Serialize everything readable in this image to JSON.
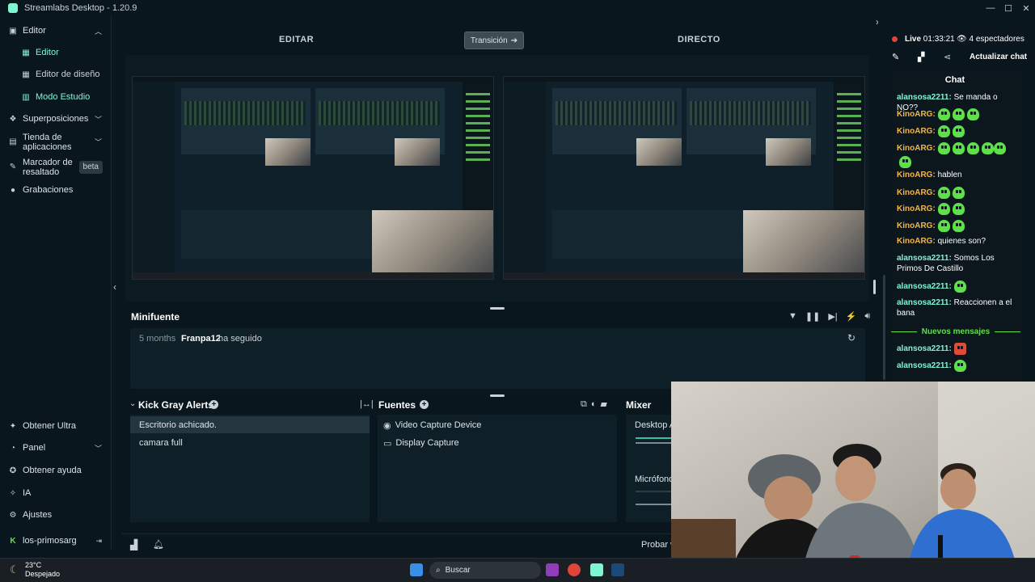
{
  "window": {
    "title": "Streamlabs Desktop - 1.20.9",
    "controls": [
      "—",
      "☐",
      "✕"
    ]
  },
  "sidebar": {
    "editor": "Editor",
    "editor_sub": [
      {
        "label": "Editor",
        "icon": "scene-icon",
        "active": true
      },
      {
        "label": "Editor de diseño",
        "icon": "layout-icon",
        "active": false
      },
      {
        "label": "Modo Estudio",
        "icon": "studio-icon",
        "active": true
      }
    ],
    "items": [
      {
        "label": "Superposiciones",
        "icon": "overlay-icon"
      },
      {
        "label": "Tienda de aplicaciones",
        "icon": "store-icon"
      },
      {
        "label": "Marcador de resaltado",
        "icon": "highlighter-icon",
        "badge": "beta"
      },
      {
        "label": "Grabaciones",
        "icon": "recordings-icon"
      }
    ],
    "bottom": [
      {
        "label": "Obtener Ultra",
        "icon": "ultra-icon"
      },
      {
        "label": "Panel",
        "icon": "dashboard-icon"
      },
      {
        "label": "Obtener ayuda",
        "icon": "help-icon"
      },
      {
        "label": "IA",
        "icon": "ai-icon"
      },
      {
        "label": "Ajustes",
        "icon": "settings-icon"
      },
      {
        "label": "los-primosarg",
        "icon": "kick-icon"
      }
    ]
  },
  "header": {
    "edit": "EDITAR",
    "transition": "Transición",
    "live": "DIRECTO"
  },
  "minifuente": {
    "title": "Minifuente",
    "event": {
      "time": "5 months",
      "user": "Franpa12",
      "action": "ha seguido"
    }
  },
  "scenes": {
    "title": "Kick Gray Alerts",
    "items": [
      "Escritorio achicado.",
      "camara full"
    ]
  },
  "sources": {
    "title": "Fuentes",
    "items": [
      "Video Capture Device",
      "Display Capture"
    ]
  },
  "mixer": {
    "title": "Mixer",
    "items": [
      "Desktop A",
      "Micrófono"
    ]
  },
  "bottombar": {
    "test": "Probar w"
  },
  "stream": {
    "live": "Live",
    "time": "01:33:21",
    "viewers": "4 espectadores",
    "refresh_chat": "Actualizar chat"
  },
  "chat": {
    "title": "Chat",
    "new_messages": "Nuevos mensajes",
    "lines": [
      {
        "user": "alansosa2211:",
        "text": "Se manda o NO??",
        "kind": "a"
      },
      {
        "user": "KinoARG:",
        "text": "",
        "kind": "k",
        "emotes": 3
      },
      {
        "user": "KinoARG:",
        "text": "",
        "kind": "k",
        "emotes": 2
      },
      {
        "user": "KinoARG:",
        "text": "",
        "kind": "k",
        "emotes": 6
      },
      {
        "user": "KinoARG:",
        "text": "hablen",
        "kind": "k"
      },
      {
        "user": "KinoARG:",
        "text": "",
        "kind": "k",
        "emotes": 2
      },
      {
        "user": "KinoARG:",
        "text": "",
        "kind": "k",
        "emotes": 2
      },
      {
        "user": "KinoARG:",
        "text": "",
        "kind": "k",
        "emotes": 2
      },
      {
        "user": "KinoARG:",
        "text": "quienes son?",
        "kind": "k"
      },
      {
        "user": "alansosa2211:",
        "text": "Somos Los Primos De Castillo",
        "kind": "a"
      },
      {
        "user": "alansosa2211:",
        "text": "",
        "kind": "a",
        "emotes": 1
      },
      {
        "user": "alansosa2211:",
        "text": "Reaccionen a el bana",
        "kind": "a"
      },
      {
        "user": "alansosa2211:",
        "text": "",
        "kind": "a",
        "emotes": 1
      },
      {
        "user": "alansosa2211:",
        "text": "",
        "kind": "a",
        "emotes": 1
      }
    ]
  },
  "taskbar": {
    "temp": "23°C",
    "weather": "Despejado",
    "search": "Buscar"
  },
  "colors": {
    "accent": "#80f5d2",
    "kick_green": "#5ee04a",
    "kino": "#f3b64c",
    "bg": "#09161d"
  }
}
